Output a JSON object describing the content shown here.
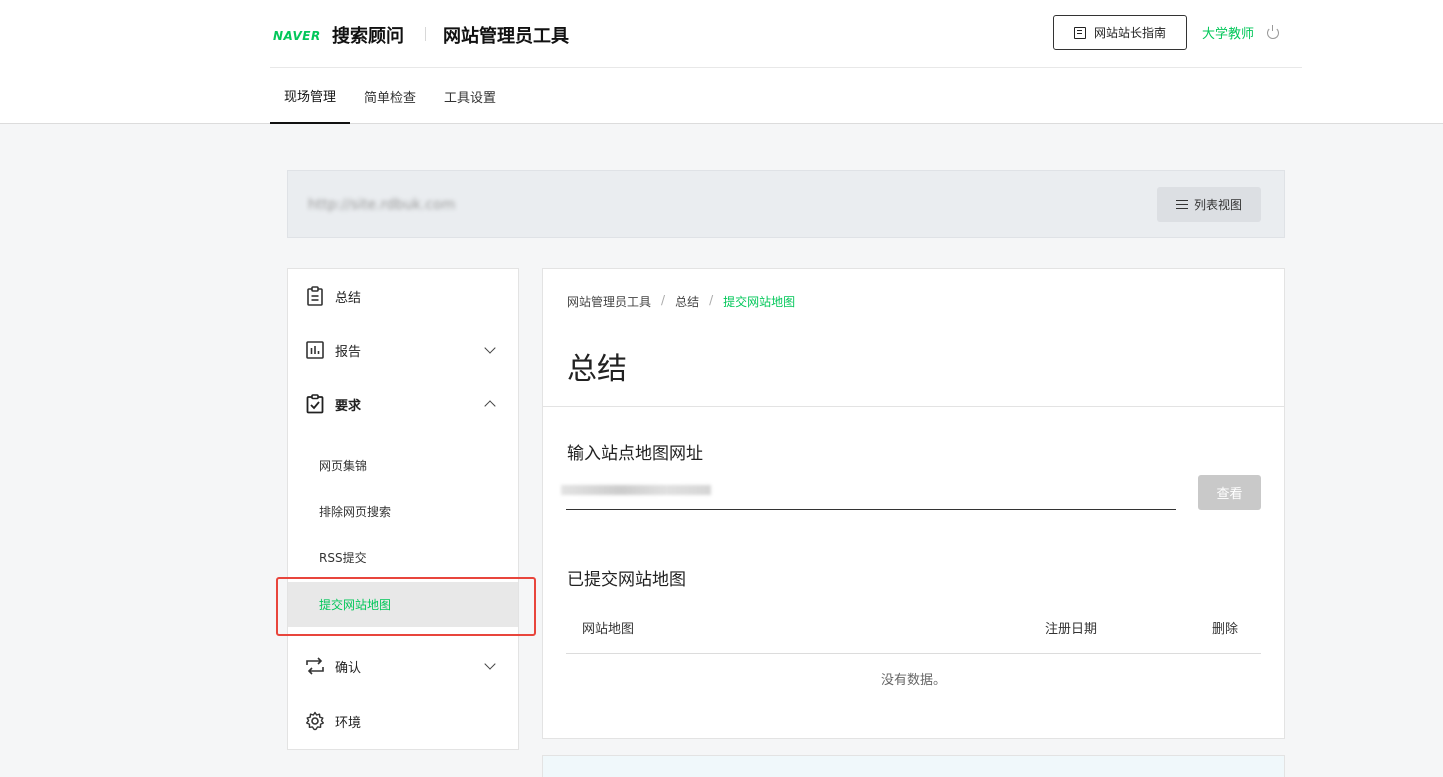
{
  "header": {
    "logo_brand": "NAVER",
    "logo_search": "搜索顾问",
    "logo_tool": "网站管理员工具",
    "guide_button": "网站站长指南",
    "user_name": "大学教师"
  },
  "tabs": [
    {
      "label": "现场管理",
      "active": true
    },
    {
      "label": "简单检查",
      "active": false
    },
    {
      "label": "工具设置",
      "active": false
    }
  ],
  "site": {
    "url": "http://site.rdbuk.com",
    "list_view_button": "列表视图"
  },
  "sidebar": {
    "summary": "总结",
    "report": "报告",
    "requests": "要求",
    "sub_items": [
      "网页集锦",
      "排除网页搜索",
      "RSS提交",
      "提交网站地图"
    ],
    "confirm": "确认",
    "environment": "环境"
  },
  "main": {
    "breadcrumb": [
      "网站管理员工具",
      "总结",
      "提交网站地图"
    ],
    "breadcrumb_sep": "/",
    "title": "总结",
    "input_section_title": "输入站点地图网址",
    "input_value": "",
    "check_button": "查看",
    "submitted_title": "已提交网站地图",
    "table_headers": [
      "网站地图",
      "注册日期",
      "删除"
    ],
    "empty_text": "没有数据。"
  },
  "colors": {
    "accent": "#03c75a",
    "highlight": "#e8453c"
  }
}
